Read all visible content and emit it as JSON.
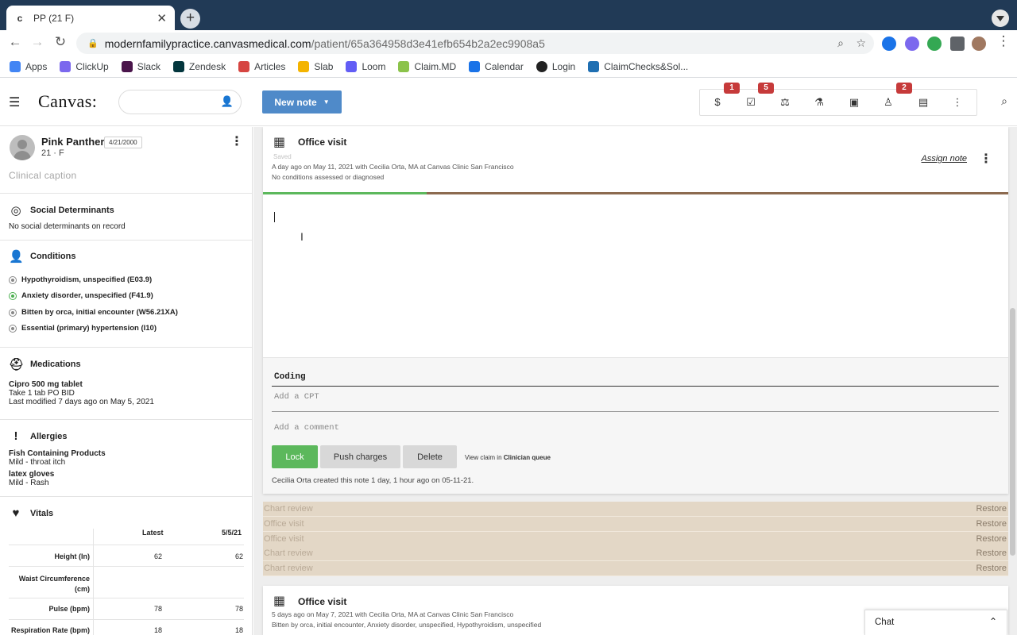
{
  "browser": {
    "tab_title": "PP (21 F)",
    "tab_favicon": "c",
    "tab_close": "✕",
    "new_tab": "+",
    "url_host": "modernfamilypractice.canvasmedical.com",
    "url_path": "/patient/65a364958d3e41efb654b2a2ec9908a5",
    "bookmarks": [
      {
        "label": "Apps",
        "color": "#4285f4"
      },
      {
        "label": "ClickUp",
        "color": "#7b68ee"
      },
      {
        "label": "Slack",
        "color": "#4a154b"
      },
      {
        "label": "Zendesk",
        "color": "#03363d"
      },
      {
        "label": "Articles",
        "color": "#d64541"
      },
      {
        "label": "Slab",
        "color": "#f4b400"
      },
      {
        "label": "Loom",
        "color": "#625df5"
      },
      {
        "label": "Claim.MD",
        "color": "#8bc34a"
      },
      {
        "label": "Calendar",
        "color": "#1a73e8"
      },
      {
        "label": "Login",
        "color": "#222222"
      },
      {
        "label": "ClaimChecks&Sol...",
        "color": "#1f6fb2"
      }
    ]
  },
  "header": {
    "logo": "Canvas:",
    "new_note_label": "New note",
    "badges": {
      "billing": "1",
      "tasks": "5",
      "referrals": "2"
    }
  },
  "patient": {
    "name": "Pink Panther",
    "dob": "4/21/2000",
    "age_sex": "21 · F",
    "caption": "Clinical caption"
  },
  "sidebar": {
    "social": {
      "title": "Social Determinants",
      "text": "No social determinants on record"
    },
    "conditions": {
      "title": "Conditions",
      "items": [
        "Hypothyroidism, unspecified (E03.9)",
        "Anxiety disorder, unspecified (F41.9)",
        "Bitten by orca, initial encounter (W56.21XA)",
        "Essential (primary) hypertension (I10)"
      ]
    },
    "medications": {
      "title": "Medications",
      "name": "Cipro 500 mg tablet",
      "sig": "Take 1 tab PO BID",
      "modified": "Last modified 7 days ago on May 5, 2021"
    },
    "allergies": {
      "title": "Allergies",
      "items": [
        {
          "name": "Fish Containing Products",
          "detail": "Mild - throat itch"
        },
        {
          "name": "latex gloves",
          "detail": "Mild - Rash"
        }
      ]
    },
    "vitals": {
      "title": "Vitals",
      "col_latest": "Latest",
      "col_date": "5/5/21",
      "rows": [
        {
          "label": "Height (In)",
          "latest": "62",
          "date": "62"
        },
        {
          "label": "Waist Circumference (cm)",
          "latest": "",
          "date": ""
        },
        {
          "label": "Pulse (bpm)",
          "latest": "78",
          "date": "78"
        },
        {
          "label": "Respiration Rate (bpm)",
          "latest": "18",
          "date": "18"
        }
      ]
    }
  },
  "note": {
    "title": "Office visit",
    "saved": "Saved",
    "meta": "A day ago on May 11, 2021 with Cecilia Orta, MA at Canvas Clinic San Francisco",
    "conditions": "No conditions assessed or diagnosed",
    "assign": "Assign note",
    "progress": 0.22,
    "coding_title": "Coding",
    "cpt_placeholder": "Add a CPT",
    "comment_placeholder": "Add a comment",
    "lock": "Lock",
    "push": "Push charges",
    "delete": "Delete",
    "view_claim_prefix": "View claim in",
    "view_claim_link": "Clinician queue",
    "creator": "Cecilia Orta created this note 1 day, 1 hour ago on 05-11-21."
  },
  "history": [
    {
      "label": "Chart review",
      "action": "Restore"
    },
    {
      "label": "Office visit",
      "action": "Restore"
    },
    {
      "label": "Office visit",
      "action": "Restore"
    },
    {
      "label": "Chart review",
      "action": "Restore"
    },
    {
      "label": "Chart review",
      "action": "Restore"
    }
  ],
  "note2": {
    "title": "Office visit",
    "meta": "5 days ago on May 7, 2021 with Cecilia Orta, MA at Canvas Clinic San Francisco",
    "conditions": "Bitten by orca, initial encounter, Anxiety disorder, unspecified, Hypothyroidism, unspecified"
  },
  "chat": {
    "label": "Chat"
  }
}
